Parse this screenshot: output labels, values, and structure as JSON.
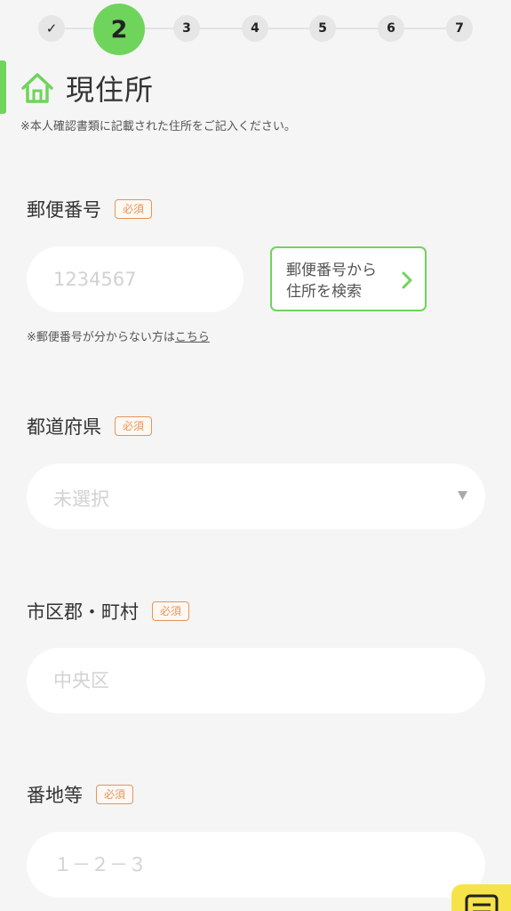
{
  "stepper": {
    "steps": [
      {
        "label": "✓",
        "state": "done"
      },
      {
        "label": "2",
        "state": "active"
      },
      {
        "label": "3",
        "state": "todo"
      },
      {
        "label": "4",
        "state": "todo"
      },
      {
        "label": "5",
        "state": "todo"
      },
      {
        "label": "6",
        "state": "todo"
      },
      {
        "label": "7",
        "state": "todo"
      }
    ]
  },
  "section": {
    "icon": "home-icon",
    "title": "現住所",
    "note": "※本人確認書類に記載された住所をご記入ください。"
  },
  "required_label": "必須",
  "fields": {
    "zip": {
      "label": "郵便番号",
      "placeholder": "1234567",
      "search_button_line1": "郵便番号から",
      "search_button_line2": "住所を検索",
      "help_text": "※郵便番号が分からない方は",
      "help_link": "こちら"
    },
    "prefecture": {
      "label": "都道府県",
      "selected": "未選択"
    },
    "city": {
      "label": "市区郡・町村",
      "placeholder": "中央区"
    },
    "address": {
      "label": "番地等",
      "placeholder": "１－２－３"
    }
  },
  "colors": {
    "accent_green": "#6fd45b",
    "required_orange": "#e3955a",
    "menu_yellow": "#f6e34a",
    "background": "#f5f5f5"
  }
}
